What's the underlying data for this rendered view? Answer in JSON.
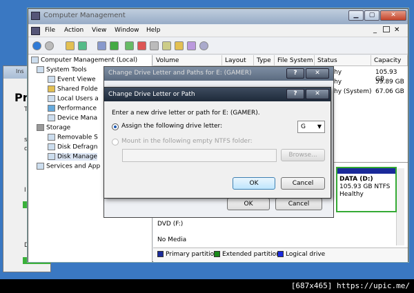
{
  "main_window": {
    "title": "Computer Management",
    "menu": [
      "File",
      "Action",
      "View",
      "Window",
      "Help"
    ],
    "tree": [
      {
        "label": "Computer Management (Local)",
        "indent": 0
      },
      {
        "label": "System Tools",
        "indent": 1
      },
      {
        "label": "Event Viewe",
        "indent": 2
      },
      {
        "label": "Shared Folde",
        "indent": 2
      },
      {
        "label": "Local Users a",
        "indent": 2
      },
      {
        "label": "Performance",
        "indent": 2
      },
      {
        "label": "Device Mana",
        "indent": 2
      },
      {
        "label": "Storage",
        "indent": 1
      },
      {
        "label": "Removable S",
        "indent": 2
      },
      {
        "label": "Disk Defragn",
        "indent": 2
      },
      {
        "label": "Disk Manage",
        "indent": 2
      },
      {
        "label": "Services and App",
        "indent": 1
      }
    ],
    "columns": [
      "Volume",
      "Layout",
      "Type",
      "File System",
      "Status",
      "Capacity"
    ],
    "rows": [
      {
        "status": "hy",
        "capacity": "105.93 GB"
      },
      {
        "status": "hy",
        "capacity": "59.89 GB"
      },
      {
        "status": "hy (System)",
        "capacity": "67.06 GB"
      }
    ],
    "disk_panel": {
      "name": "DATA  (D:)",
      "size": "105.93 GB NTFS",
      "status": "Healthy"
    },
    "dvd_label": "DVD (F:)",
    "no_media": "No Media",
    "legend": [
      {
        "label": "Primary partition",
        "color": "#1a2a9a"
      },
      {
        "label": "Extended partition",
        "color": "#1a8a1a"
      },
      {
        "label": "Logical drive",
        "color": "#1a2adf"
      }
    ]
  },
  "bg_window": {
    "title": "Ins",
    "heading": "Pr",
    "lines": [
      "T",
      "s",
      "d",
      "I",
      "D"
    ]
  },
  "dialog_outer": {
    "title": "Change Drive Letter and Paths for E: (GAMER)",
    "help": "?",
    "close": "✕",
    "ok": "OK",
    "cancel": "Cancel"
  },
  "dialog_inner": {
    "title": "Change Drive Letter or Path",
    "help": "?",
    "close": "✕",
    "prompt": "Enter a new drive letter or path for E: (GAMER).",
    "option_assign": "Assign the following drive letter:",
    "drive_letter": "G",
    "option_mount": "Mount in the following empty NTFS folder:",
    "browse": "Browse...",
    "ok": "OK",
    "cancel": "Cancel"
  },
  "watermark": "[687x465] https://upic.me/"
}
